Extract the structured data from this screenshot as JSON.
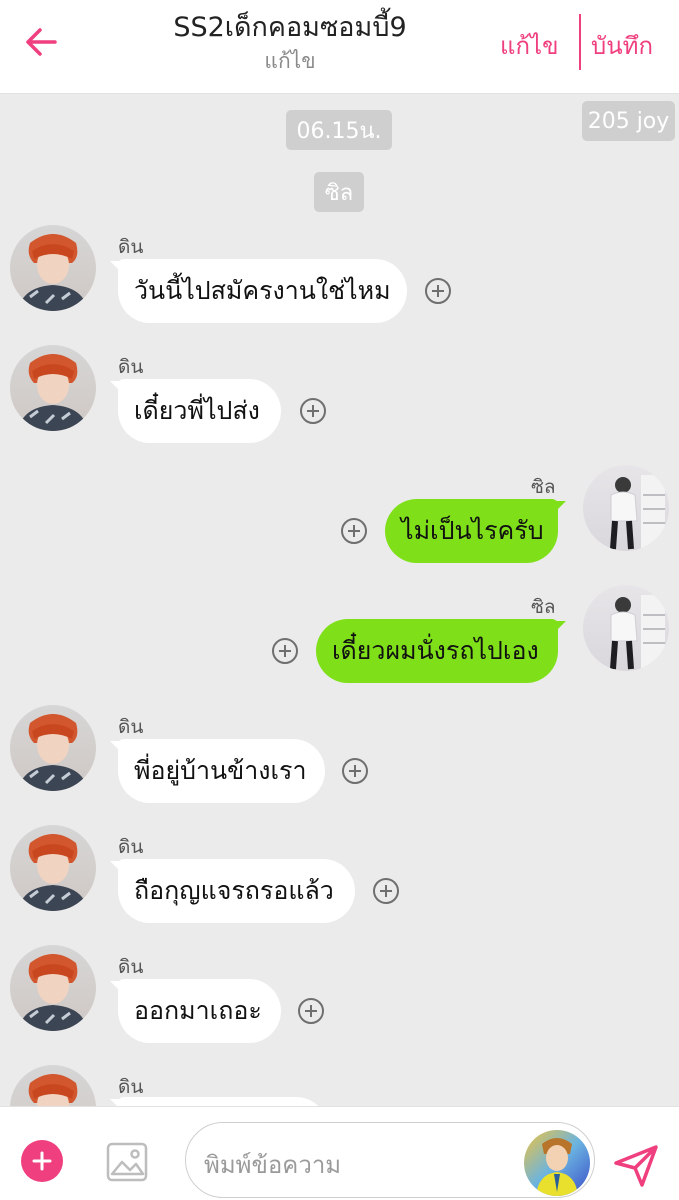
{
  "header": {
    "title": "SS2เด็กคอมซอมบี้9",
    "subtitle": "แก้ไข",
    "edit_label": "แก้ไข",
    "save_label": "บันทึก",
    "accent_color": "#ef3f7e"
  },
  "chat": {
    "time_label": "06.15น.",
    "count_label": "205 joy",
    "speaker_chip": "ซิล",
    "messages": [
      {
        "sender": "ดิน",
        "text": "วันนี้ไปสมัครงานใช่ไหม",
        "side": "in"
      },
      {
        "sender": "ดิน",
        "text": "เดี๋ยวพี่ไปส่ง",
        "side": "in"
      },
      {
        "sender": "ซิล",
        "text": "ไม่เป็นไรครับ",
        "side": "out"
      },
      {
        "sender": "ซิล",
        "text": "เดี๋ยวผมนั่งรถไปเอง",
        "side": "out"
      },
      {
        "sender": "ดิน",
        "text": "พี่อยู่บ้านข้างเรา",
        "side": "in"
      },
      {
        "sender": "ดิน",
        "text": "ถือกุญแจรถรอแล้ว",
        "side": "in"
      },
      {
        "sender": "ดิน",
        "text": "ออกมาเถอะ",
        "side": "in"
      },
      {
        "sender": "ดิน",
        "text": "",
        "side": "in"
      }
    ],
    "outgoing_bubble_color": "#7fe01a",
    "incoming_bubble_color": "#ffffff"
  },
  "composer": {
    "placeholder": "พิมพ์ข้อความ",
    "add_icon": "plus-circle-icon",
    "image_icon": "image-icon",
    "send_icon": "send-icon"
  }
}
